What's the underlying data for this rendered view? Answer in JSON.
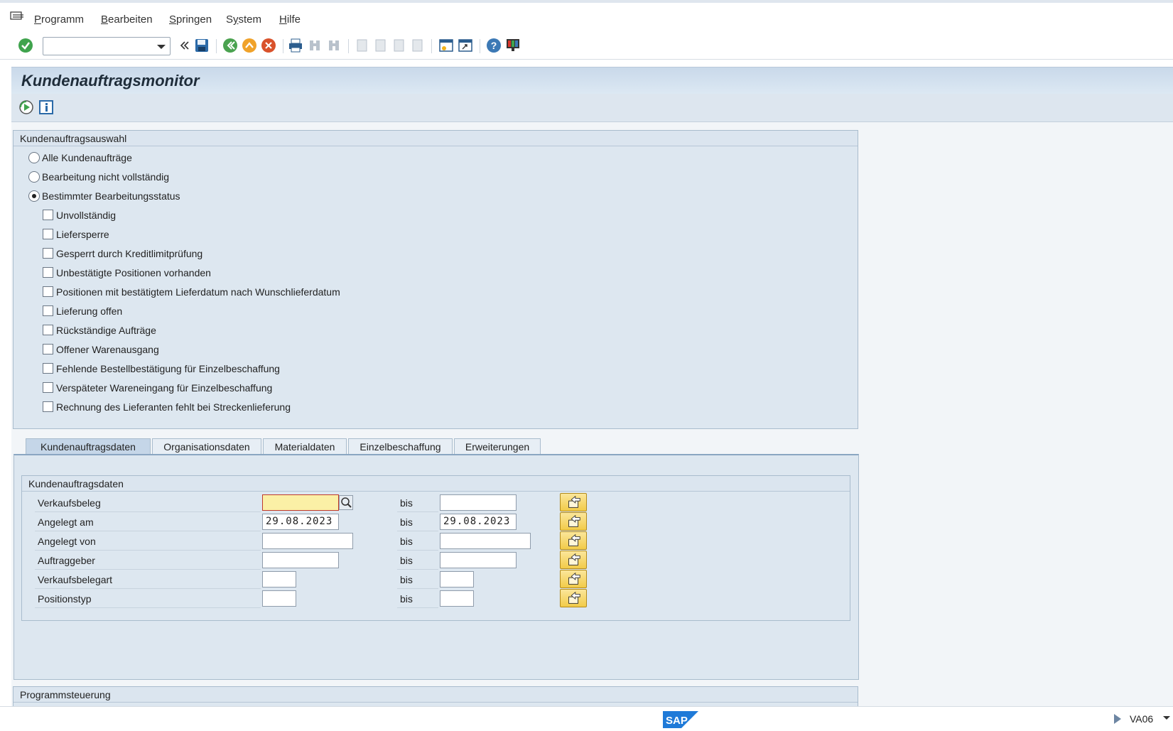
{
  "menu": {
    "items": [
      {
        "label": "Programm",
        "accel": "P"
      },
      {
        "label": "Bearbeiten",
        "accel": "B"
      },
      {
        "label": "Springen",
        "accel": "S"
      },
      {
        "label": "System",
        "accel": "y"
      },
      {
        "label": "Hilfe",
        "accel": "H"
      }
    ]
  },
  "toolbar": {
    "command_field_value": "",
    "icons": [
      "enter-icon",
      "command-field",
      "collapse-icon",
      "save-icon",
      "back-icon",
      "exit-icon",
      "cancel-icon",
      "print-icon",
      "find-icon",
      "find-next-icon",
      "first-page-icon",
      "previous-page-icon",
      "next-page-icon",
      "last-page-icon",
      "new-session-icon",
      "create-shortcut-icon",
      "help-icon",
      "customize-layout-icon"
    ]
  },
  "title": {
    "text": "Kundenauftragsmonitor"
  },
  "application_toolbar": {
    "icons": [
      "execute-icon",
      "info-icon"
    ]
  },
  "selection_group": {
    "title": "Kundenauftragsauswahl",
    "radios": [
      {
        "label": "Alle Kundenaufträge",
        "selected": false
      },
      {
        "label": "Bearbeitung nicht vollständig",
        "selected": false
      },
      {
        "label": "Bestimmter Bearbeitungsstatus",
        "selected": true
      }
    ],
    "checkboxes": [
      {
        "label": "Unvollständig",
        "checked": false
      },
      {
        "label": "Liefersperre",
        "checked": false
      },
      {
        "label": "Gesperrt durch Kreditlimitprüfung",
        "checked": false
      },
      {
        "label": "Unbestätigte Positionen vorhanden",
        "checked": false
      },
      {
        "label": "Positionen mit bestätigtem Lieferdatum nach Wunschlieferdatum",
        "checked": false
      },
      {
        "label": "Lieferung offen",
        "checked": false
      },
      {
        "label": "Rückständige Aufträge",
        "checked": false
      },
      {
        "label": "Offener Warenausgang",
        "checked": false
      },
      {
        "label": "Fehlende Bestellbestätigung für Einzelbeschaffung",
        "checked": false
      },
      {
        "label": "Verspäteter Wareneingang für Einzelbeschaffung",
        "checked": false
      },
      {
        "label": "Rechnung des Lieferanten fehlt bei Streckenlieferung",
        "checked": false
      }
    ]
  },
  "tabs": [
    {
      "label": "Kundenauftragsdaten",
      "active": true
    },
    {
      "label": "Organisationsdaten",
      "active": false
    },
    {
      "label": "Materialdaten",
      "active": false
    },
    {
      "label": "Einzelbeschaffung",
      "active": false
    },
    {
      "label": "Erweiterungen",
      "active": false
    }
  ],
  "order_data": {
    "title": "Kundenauftragsdaten",
    "bis_label": "bis",
    "rows": [
      {
        "label": "Verkaufsbeleg",
        "from": "",
        "to": ""
      },
      {
        "label": "Angelegt am",
        "from": "29.08.2023",
        "to": "29.08.2023"
      },
      {
        "label": "Angelegt von",
        "from": "",
        "to": ""
      },
      {
        "label": "Auftraggeber",
        "from": "",
        "to": ""
      },
      {
        "label": "Verkaufsbelegart",
        "from": "",
        "to": ""
      },
      {
        "label": "Positionstyp",
        "from": "",
        "to": ""
      }
    ]
  },
  "program_control": {
    "title": "Programmsteuerung"
  },
  "statusbar": {
    "logo_text": "SAP",
    "transaction": "VA06"
  },
  "colors": {
    "accent": "#1f2d3a",
    "focus_field": "#fbf0a6",
    "multi_select_button": "#f2cb48"
  }
}
